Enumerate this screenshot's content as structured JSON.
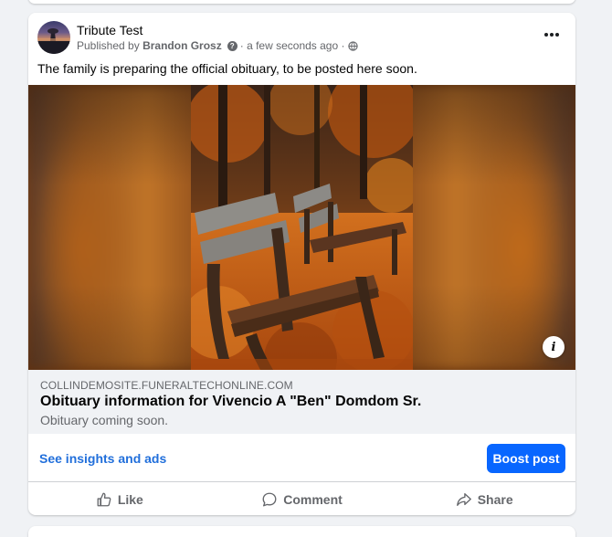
{
  "post": {
    "page_name": "Tribute Test",
    "published_by_prefix": "Published by",
    "author": "Brandon Grosz",
    "help_icon_glyph": "?",
    "time_separator": "·",
    "time": "a few seconds ago",
    "audience_separator": "·",
    "audience_icon": "globe-icon",
    "more_icon": "more-options-icon",
    "text": "The family is preparing the official obituary, to be posted here soon."
  },
  "link_preview": {
    "domain": "COLLINDEMOSITE.FUNERALTECHONLINE.COM",
    "title": "Obituary information for Vivencio A \"Ben\" Domdom Sr.",
    "description": "Obituary coming soon.",
    "info_icon_glyph": "i"
  },
  "insights": {
    "link_label": "See insights and ads",
    "boost_label": "Boost post"
  },
  "actions": [
    {
      "label": "Like",
      "icon": "like-icon"
    },
    {
      "label": "Comment",
      "icon": "comment-icon"
    },
    {
      "label": "Share",
      "icon": "share-icon"
    }
  ],
  "colors": {
    "accent": "#0866ff",
    "link": "#216fdb",
    "secondary_text": "#65676b",
    "background": "#f0f2f5"
  }
}
